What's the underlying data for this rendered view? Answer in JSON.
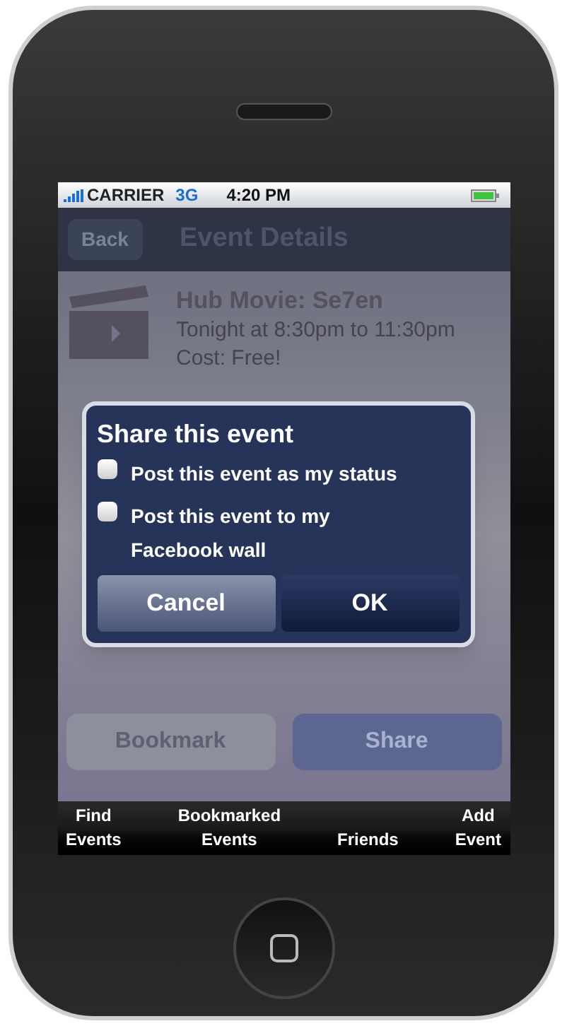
{
  "status_bar": {
    "carrier": "CARRIER",
    "network": "3G",
    "time": "4:20 PM"
  },
  "nav_bar": {
    "back": "Back",
    "title": "Event Details"
  },
  "event": {
    "title": "Hub Movie: Se7en",
    "time": "Tonight at 8:30pm to 11:30pm",
    "cost": "Cost: Free!"
  },
  "dialog": {
    "title": "Share this event",
    "options": [
      {
        "label": "Post this event as my status",
        "checked": false
      },
      {
        "label": "Post this event to my Facebook wall",
        "checked": false
      }
    ],
    "buttons": [
      {
        "label": "Cancel",
        "kind": "secondary"
      },
      {
        "label": "OK",
        "kind": "primary"
      }
    ]
  },
  "actions": [
    {
      "label": "Bookmark",
      "kind": "secondary"
    },
    {
      "label": "Share",
      "kind": "primary"
    }
  ],
  "tab_bar": [
    {
      "lines": [
        "Find",
        "Events"
      ]
    },
    {
      "lines": [
        "Bookmarked",
        "Events"
      ]
    },
    {
      "lines": [
        "Friends"
      ]
    },
    {
      "lines": [
        "Add",
        "Event"
      ]
    }
  ]
}
